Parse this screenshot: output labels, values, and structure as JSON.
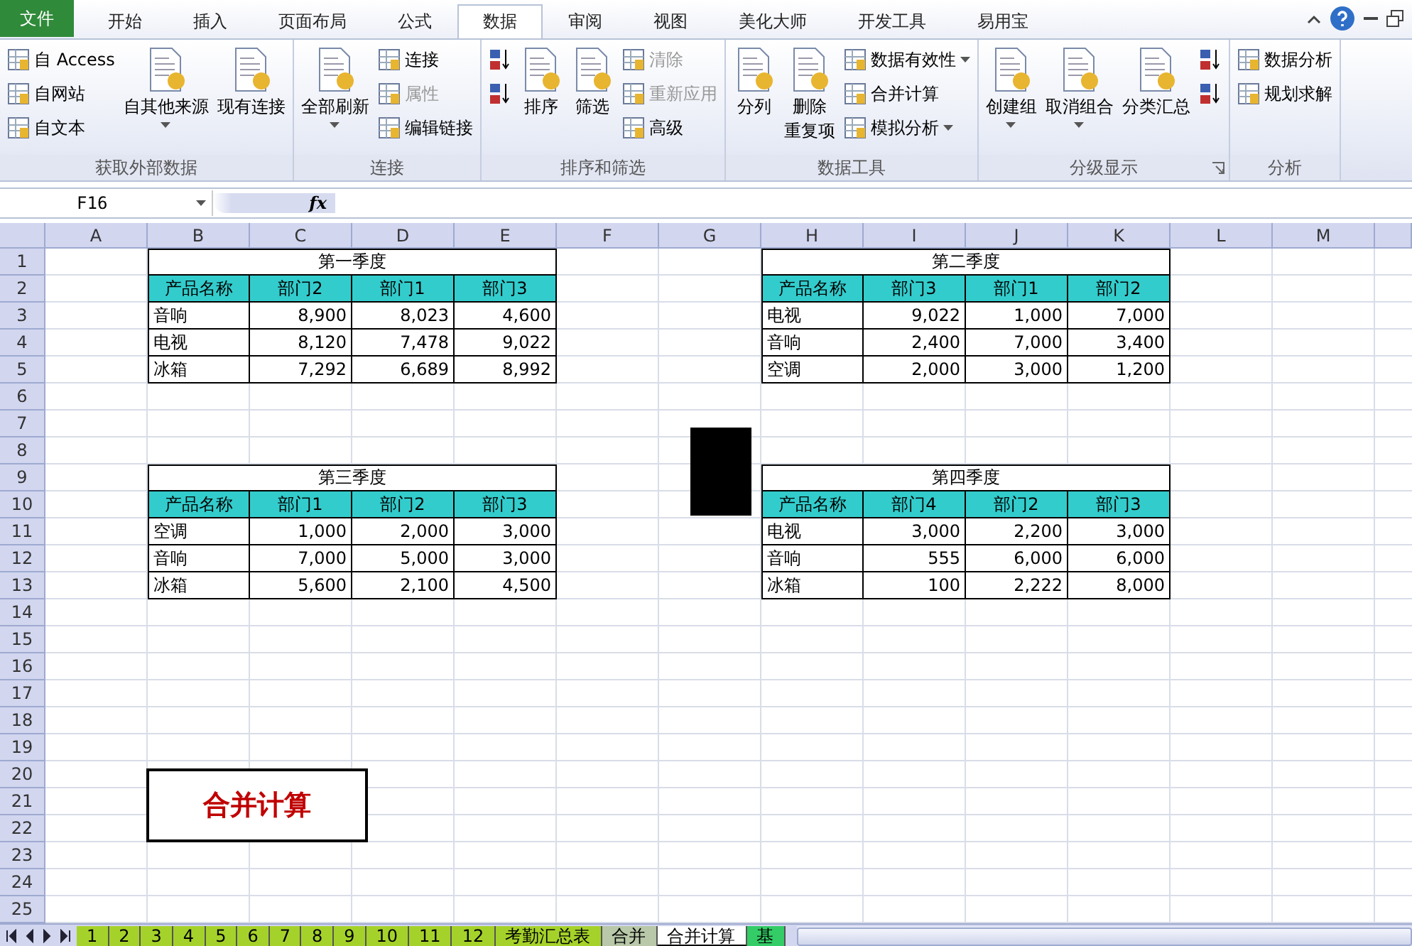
{
  "ribbon": {
    "file_tab": "文件",
    "tabs": [
      {
        "label": "开始",
        "selected": false
      },
      {
        "label": "插入",
        "selected": false
      },
      {
        "label": "页面布局",
        "selected": false
      },
      {
        "label": "公式",
        "selected": false
      },
      {
        "label": "数据",
        "selected": true
      },
      {
        "label": "审阅",
        "selected": false
      },
      {
        "label": "视图",
        "selected": false
      },
      {
        "label": "美化大师",
        "selected": false
      },
      {
        "label": "开发工具",
        "selected": false
      },
      {
        "label": "易用宝",
        "selected": false
      }
    ],
    "groups": [
      {
        "label": "获取外部数据",
        "columns": [
          [
            {
              "kind": "small",
              "label": "自 Access"
            },
            {
              "kind": "small",
              "label": "自网站"
            },
            {
              "kind": "small",
              "label": "自文本"
            }
          ],
          [
            {
              "kind": "large",
              "lines": [
                "自其他来源"
              ],
              "dropdown": true
            }
          ],
          [
            {
              "kind": "large",
              "lines": [
                "现有连接"
              ]
            }
          ]
        ]
      },
      {
        "label": "连接",
        "columns": [
          [
            {
              "kind": "large",
              "lines": [
                "全部刷新"
              ],
              "dropdown": true
            }
          ],
          [
            {
              "kind": "small",
              "label": "连接"
            },
            {
              "kind": "small",
              "label": "属性",
              "disabled": true
            },
            {
              "kind": "small",
              "label": "编辑链接"
            }
          ]
        ]
      },
      {
        "label": "排序和筛选",
        "columns": [
          [
            {
              "kind": "sort"
            },
            {
              "kind": "sort"
            }
          ],
          [
            {
              "kind": "large",
              "lines": [
                "排序"
              ]
            }
          ],
          [
            {
              "kind": "large",
              "lines": [
                "筛选"
              ]
            }
          ],
          [
            {
              "kind": "small",
              "label": "清除",
              "disabled": true
            },
            {
              "kind": "small",
              "label": "重新应用",
              "disabled": true
            },
            {
              "kind": "small",
              "label": "高级"
            }
          ]
        ]
      },
      {
        "label": "数据工具",
        "columns": [
          [
            {
              "kind": "large",
              "lines": [
                "分列"
              ]
            }
          ],
          [
            {
              "kind": "large",
              "lines": [
                "删除",
                "重复项"
              ]
            }
          ],
          [
            {
              "kind": "small",
              "label": "数据有效性",
              "dropdown": true
            },
            {
              "kind": "small",
              "label": "合并计算"
            },
            {
              "kind": "small",
              "label": "模拟分析",
              "dropdown": true
            }
          ]
        ]
      },
      {
        "label": "分级显示",
        "launcher": true,
        "columns": [
          [
            {
              "kind": "large",
              "lines": [
                "创建组"
              ],
              "dropdown": true
            }
          ],
          [
            {
              "kind": "large",
              "lines": [
                "取消组合"
              ],
              "dropdown": true
            }
          ],
          [
            {
              "kind": "large",
              "lines": [
                "分类汇总"
              ]
            }
          ],
          [
            {
              "kind": "sort"
            },
            {
              "kind": "sort"
            }
          ]
        ]
      },
      {
        "label": "分析",
        "columns": [
          [
            {
              "kind": "small",
              "label": "数据分析"
            },
            {
              "kind": "small",
              "label": "规划求解"
            }
          ]
        ]
      }
    ]
  },
  "formula_bar": {
    "name_box": "F16",
    "fx": "fx"
  },
  "sheet": {
    "columns": [
      "A",
      "B",
      "C",
      "D",
      "E",
      "F",
      "G",
      "H",
      "I",
      "J",
      "K",
      "L",
      "M"
    ],
    "rows": [
      "1",
      "2",
      "3",
      "4",
      "5",
      "6",
      "7",
      "8",
      "9",
      "10",
      "11",
      "12",
      "13",
      "14",
      "15",
      "16",
      "17",
      "18",
      "19",
      "20",
      "21",
      "22",
      "23",
      "24",
      "25"
    ],
    "tables": [
      {
        "title": "第一季度",
        "columns": [
          "产品名称",
          "部门2",
          "部门1",
          "部门3"
        ],
        "rows": [
          [
            "音响",
            "8,900",
            "8,023",
            "4,600"
          ],
          [
            "电视",
            "8,120",
            "7,478",
            "9,022"
          ],
          [
            "冰箱",
            "7,292",
            "6,689",
            "8,992"
          ]
        ]
      },
      {
        "title": "第二季度",
        "columns": [
          "产品名称",
          "部门3",
          "部门1",
          "部门2"
        ],
        "rows": [
          [
            "电视",
            "9,022",
            "1,000",
            "7,000"
          ],
          [
            "音响",
            "2,400",
            "7,000",
            "3,400"
          ],
          [
            "空调",
            "2,000",
            "3,000",
            "1,200"
          ]
        ]
      },
      {
        "title": "第三季度",
        "columns": [
          "产品名称",
          "部门1",
          "部门2",
          "部门3"
        ],
        "rows": [
          [
            "空调",
            "1,000",
            "2,000",
            "3,000"
          ],
          [
            "音响",
            "7,000",
            "5,000",
            "3,000"
          ],
          [
            "冰箱",
            "5,600",
            "2,100",
            "4,500"
          ]
        ]
      },
      {
        "title": "第四季度",
        "columns": [
          "产品名称",
          "部门4",
          "部门2",
          "部门3"
        ],
        "rows": [
          [
            "电视",
            "3,000",
            "2,200",
            "3,000"
          ],
          [
            "音响",
            "555",
            "6,000",
            "6,000"
          ],
          [
            "冰箱",
            "100",
            "2,222",
            "8,000"
          ]
        ]
      }
    ],
    "macro_button": "合并计算"
  },
  "sheet_tabs": [
    {
      "label": "1",
      "selected": false,
      "color": "#a5d22a"
    },
    {
      "label": "2",
      "selected": false,
      "color": "#a5d22a"
    },
    {
      "label": "3",
      "selected": false,
      "color": "#a5d22a"
    },
    {
      "label": "4",
      "selected": false,
      "color": "#a5d22a"
    },
    {
      "label": "5",
      "selected": false,
      "color": "#a5d22a"
    },
    {
      "label": "6",
      "selected": false,
      "color": "#a5d22a"
    },
    {
      "label": "7",
      "selected": false,
      "color": "#a5d22a"
    },
    {
      "label": "8",
      "selected": false,
      "color": "#a5d22a"
    },
    {
      "label": "9",
      "selected": false,
      "color": "#a5d22a"
    },
    {
      "label": "10",
      "selected": false,
      "color": "#a5d22a"
    },
    {
      "label": "11",
      "selected": false,
      "color": "#a5d22a"
    },
    {
      "label": "12",
      "selected": false,
      "color": "#a5d22a"
    },
    {
      "label": "考勤汇总表",
      "selected": false,
      "color": "#a5d22a"
    },
    {
      "label": "合并",
      "selected": false,
      "color": "#b8c8a8"
    },
    {
      "label": "合并计算",
      "selected": true,
      "color": "#ffffff"
    },
    {
      "label": "基",
      "selected": false,
      "color": "#33cc66"
    }
  ]
}
